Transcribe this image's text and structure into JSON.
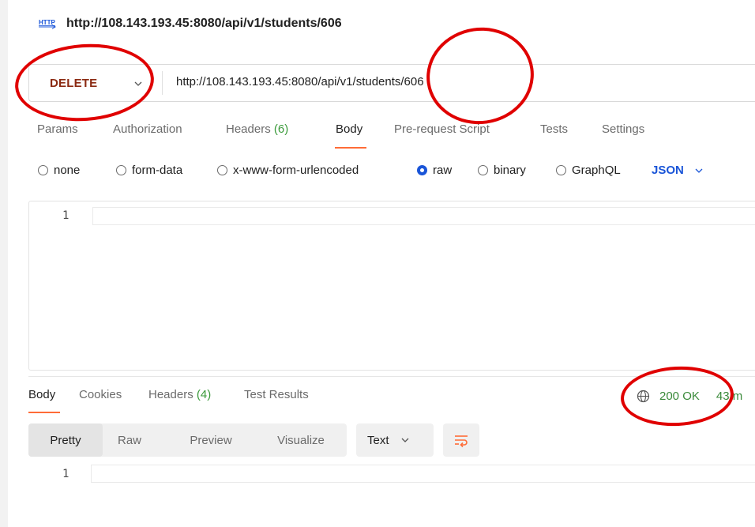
{
  "title": {
    "icon": "http-icon",
    "text": "http://108.143.193.45:8080/api/v1/students/606"
  },
  "request": {
    "method": "DELETE",
    "url": "http://108.143.193.45:8080/api/v1/students/606"
  },
  "tabs": [
    {
      "label": "Params"
    },
    {
      "label": "Authorization"
    },
    {
      "label": "Headers",
      "count": "(6)"
    },
    {
      "label": "Body",
      "active": true
    },
    {
      "label": "Pre-request Script"
    },
    {
      "label": "Tests"
    },
    {
      "label": "Settings"
    }
  ],
  "body_types": [
    {
      "label": "none",
      "selected": false
    },
    {
      "label": "form-data",
      "selected": false
    },
    {
      "label": "x-www-form-urlencoded",
      "selected": false
    },
    {
      "label": "raw",
      "selected": true
    },
    {
      "label": "binary",
      "selected": false
    },
    {
      "label": "GraphQL",
      "selected": false
    }
  ],
  "body_language": "JSON",
  "editor": {
    "line_numbers": [
      "1"
    ]
  },
  "response": {
    "tabs": [
      {
        "label": "Body",
        "active": true
      },
      {
        "label": "Cookies"
      },
      {
        "label": "Headers",
        "count": "(4)"
      },
      {
        "label": "Test Results"
      }
    ],
    "status": "200 OK",
    "status_more": "43 m",
    "format_buttons": [
      "Pretty",
      "Raw",
      "Preview",
      "Visualize"
    ],
    "active_format": "Pretty",
    "text_type": "Text",
    "line_numbers": [
      "1"
    ]
  },
  "colors": {
    "method": "#8b2a12",
    "accent": "#ff6c37",
    "link": "#1a55d8",
    "status_ok": "#3a8a3a",
    "annotation": "#e00000"
  }
}
